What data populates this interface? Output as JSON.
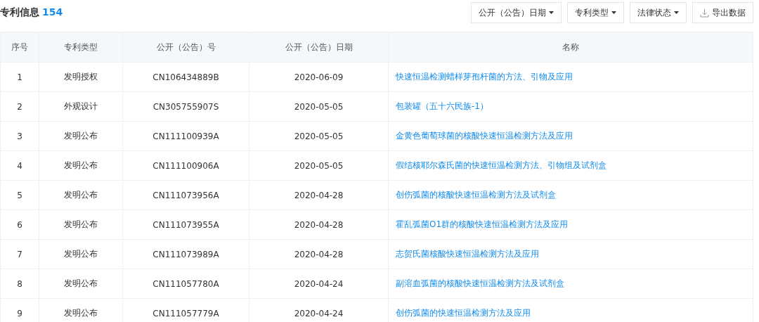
{
  "title": {
    "label": "专利信息",
    "count": "154"
  },
  "toolbar": {
    "filters": [
      {
        "label": "公开（公告）日期"
      },
      {
        "label": "专利类型"
      },
      {
        "label": "法律状态"
      }
    ],
    "export": {
      "label": "导出数据"
    }
  },
  "table": {
    "columns": [
      "序号",
      "专利类型",
      "公开（公告）号",
      "公开（公告）日期",
      "名称"
    ],
    "rows": [
      {
        "index": "1",
        "type": "发明授权",
        "number": "CN106434889B",
        "date": "2020-06-09",
        "name": "快速恒温检测蜡样芽孢杆菌的方法、引物及应用"
      },
      {
        "index": "2",
        "type": "外观设计",
        "number": "CN305755907S",
        "date": "2020-05-05",
        "name": "包装罐（五十六民族-1）"
      },
      {
        "index": "3",
        "type": "发明公布",
        "number": "CN111100939A",
        "date": "2020-05-05",
        "name": "金黄色葡萄球菌的核酸快速恒温检测方法及应用"
      },
      {
        "index": "4",
        "type": "发明公布",
        "number": "CN111100906A",
        "date": "2020-05-05",
        "name": "假结核耶尔森氏菌的快速恒温检测方法、引物组及试剂盒"
      },
      {
        "index": "5",
        "type": "发明公布",
        "number": "CN111073956A",
        "date": "2020-04-28",
        "name": "创伤弧菌的核酸快速恒温检测方法及试剂盒"
      },
      {
        "index": "6",
        "type": "发明公布",
        "number": "CN111073955A",
        "date": "2020-04-28",
        "name": "霍乱弧菌O1群的核酸快速恒温检测方法及应用"
      },
      {
        "index": "7",
        "type": "发明公布",
        "number": "CN111073989A",
        "date": "2020-04-28",
        "name": "志贺氏菌核酸快速恒温检测方法及应用"
      },
      {
        "index": "8",
        "type": "发明公布",
        "number": "CN111057780A",
        "date": "2020-04-24",
        "name": "副溶血弧菌的核酸快速恒温检测方法及试剂盒"
      },
      {
        "index": "9",
        "type": "发明公布",
        "number": "CN111057779A",
        "date": "2020-04-24",
        "name": "创伤弧菌的快速恒温检测方法及应用"
      }
    ]
  }
}
